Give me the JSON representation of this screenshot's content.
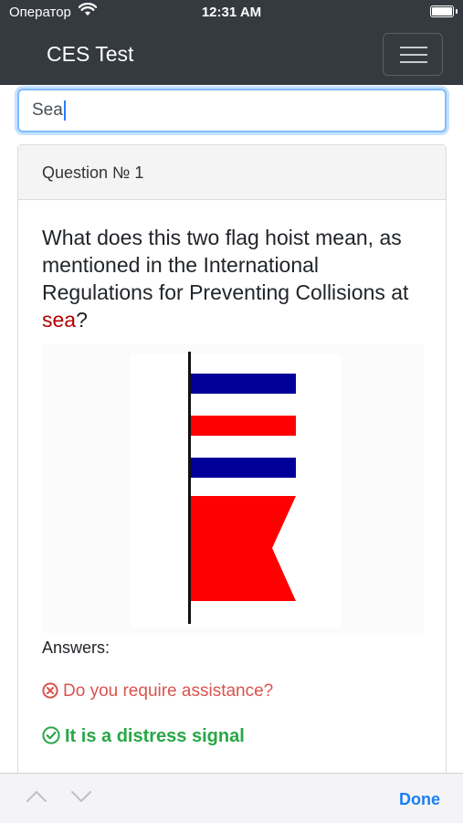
{
  "status_bar": {
    "carrier": "Оператор",
    "time": "12:31 AM"
  },
  "navbar": {
    "brand": "CES Test"
  },
  "search": {
    "value": "Sea"
  },
  "card": {
    "header": "Question № 1",
    "question_before": "What does this two flag hoist mean, as mentioned in the International Regulations for Preventing Collisions at ",
    "question_highlight": "sea",
    "question_after": "?",
    "answers_label": "Answers:",
    "answers": [
      {
        "text": "Do you require assistance?",
        "status": "wrong"
      },
      {
        "text": "It is a distress signal",
        "status": "correct"
      }
    ]
  },
  "accessory": {
    "done_label": "Done"
  },
  "colors": {
    "navbar": "#343a40",
    "wrong": "#d9534f",
    "correct": "#28a745",
    "highlight": "#b30000",
    "flag_blue": "#000099",
    "flag_red": "#ff0000"
  }
}
